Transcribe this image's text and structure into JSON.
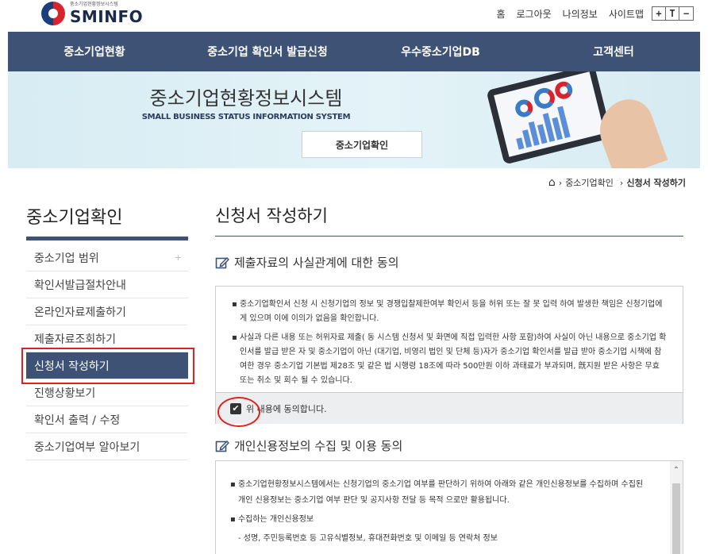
{
  "header": {
    "logo_sub": "중소기업현황정보시스템",
    "logo_main": "SMINFO",
    "util_links": [
      "홈",
      "로그아웃",
      "나의정보",
      "사이트맵"
    ],
    "font_controls": [
      "+",
      "T",
      "−"
    ]
  },
  "nav": [
    "중소기업현황",
    "중소기업 확인서 발급신청",
    "우수중소기업DB",
    "고객센터"
  ],
  "banner": {
    "title": "중소기업현황정보시스템",
    "subtitle": "SMALL BUSINESS STATUS INFORMATION SYSTEM",
    "button": "중소기업확인"
  },
  "breadcrumb": {
    "home_icon": "home-icon",
    "items": [
      "중소기업확인",
      "신청서 작성하기"
    ]
  },
  "sidebar": {
    "title": "중소기업확인",
    "items": [
      {
        "label": "중소기업 범위",
        "plus": "+"
      },
      {
        "label": "확인서발급절차안내"
      },
      {
        "label": "온라인자료제출하기"
      },
      {
        "label": "제출자료조회하기"
      },
      {
        "label": "신청서 작성하기"
      },
      {
        "label": "진행상황보기"
      },
      {
        "label": "확인서 출력 / 수정"
      },
      {
        "label": "중소기업여부 알아보기"
      }
    ]
  },
  "main": {
    "title": "신청서 작성하기",
    "section1": {
      "title": "제출자료의 사실관계에 대한 동의",
      "paragraphs": [
        "▪ 중소기업확인서 신청 시 신청기업의 정보 및 경쟁입찰제한여부 확인서 등을 허위 또는 잘 못 입력 하여 발생한 책임은 신청기업에게 있으며 이에 이의가 없음을 확인합니다.",
        "▪ 사실과 다른 내용 또는 허위자료 제출( 동 시스템 신청서 및 화면에 직접 입력한 사항 포함)하여 사실이 아닌 내용으로 중소기업 확인서를 발급 받은 자 및 중소기업이 아닌 (대기업, 비영리 법인 및 단체 등)자가 중소기업 확인서를 발급 받아 중소기업 시책에 참여한 경우 중소기업 기본법 제28조 및 같은 법 시행령 18조에 따라 500만원 이하 과태료가 부과되며, 旣지원 받은 사항은 무효 또는 취소 및 회수 될 수 있습니다."
      ],
      "checkbox_label": "위 내용에 동의합니다."
    },
    "section2": {
      "title": "개인신용정보의 수집 및 이용 동의",
      "paragraphs": [
        "▪ 중소기업현황정보시스템에서는 신청기업의 중소기업 여부를 판단하기 위하여 아래와 같은 개인신용정보를 수집하며 수집된 개인 신용정보는 중소기업 여부 판단 및 공지사항 전달 등 목적 으로만 활용됩니다.",
        "▪ 수집하는 개인신용정보",
        "- 성명, 주민등록번호 등 고유식별정보, 휴대전화번호 및 이메일 등 연락처 정보"
      ]
    }
  },
  "colors": {
    "nav_bg": "#3e5276",
    "highlight_red": "#e02020"
  }
}
